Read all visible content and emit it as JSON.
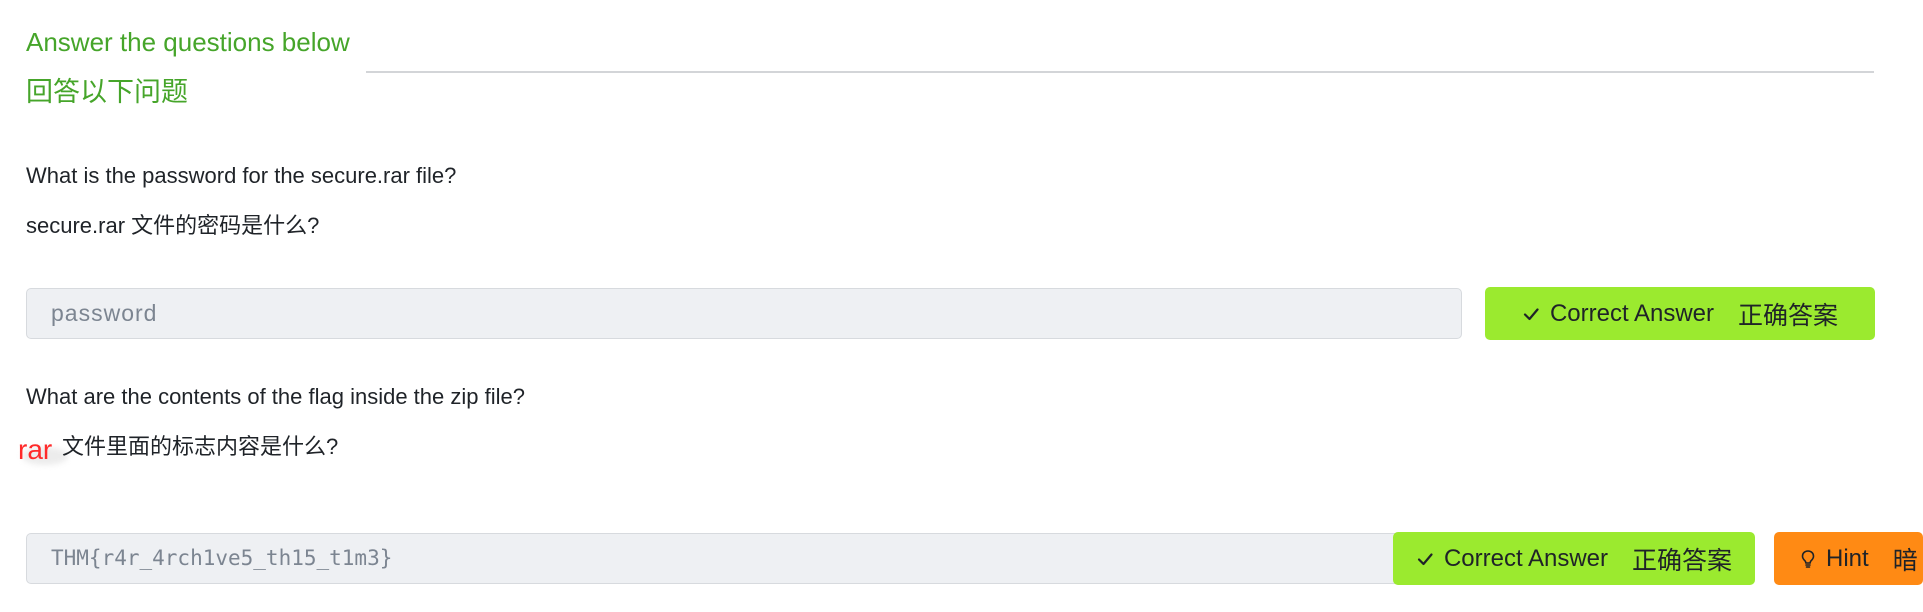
{
  "section": {
    "heading": "Answer the questions below",
    "heading_zh": "回答以下问题"
  },
  "questions": [
    {
      "text": "What is the password for the secure.rar file?",
      "text_zh": "secure.rar 文件的密码是什么?",
      "answer_placeholder": "password",
      "correct_label": "Correct Answer",
      "correct_label_zh": "正确答案"
    },
    {
      "text": "What are the contents of the flag inside the zip file?",
      "overlay_text": "rar",
      "text_zh": "文件里面的标志内容是什么?",
      "answer_value": "THM{r4r_4rch1ve5_th15_t1m3}",
      "correct_label": "Correct Answer",
      "correct_label_zh": "正确答案",
      "hint_label": "Hint",
      "hint_label_zh": "暗"
    }
  ],
  "colors": {
    "heading_green": "#46a52a",
    "correct_button": "#9bea2f",
    "hint_button": "#ff8a14",
    "overlay_red": "#ff2a2a"
  },
  "icons": {
    "correct": "check-icon",
    "hint": "lightbulb-icon"
  }
}
